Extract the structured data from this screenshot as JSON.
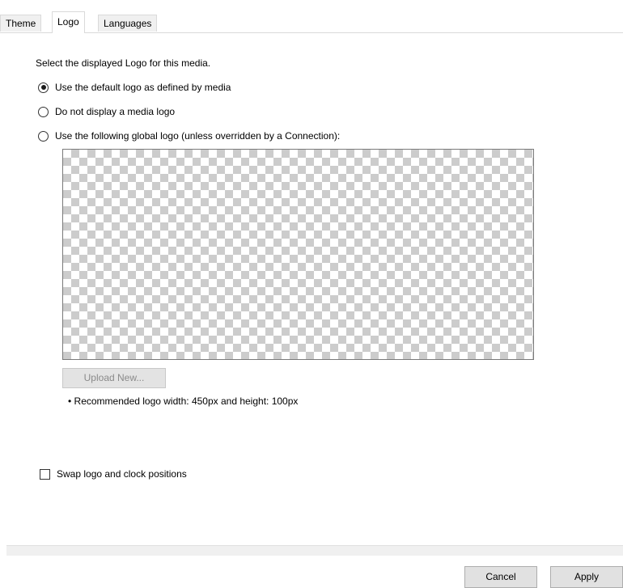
{
  "tabs": [
    {
      "label": "Theme"
    },
    {
      "label": "Logo"
    },
    {
      "label": "Languages"
    }
  ],
  "active_tab": "Logo",
  "logo": {
    "prompt": "Select the displayed Logo for this media.",
    "options": [
      {
        "label": "Use the default logo as defined by media",
        "checked": true
      },
      {
        "label": "Do not display a media logo",
        "checked": false
      },
      {
        "label": "Use the following global logo (unless overridden by a Connection):",
        "checked": false
      }
    ],
    "upload_label": "Upload New...",
    "hint": "• Recommended logo width: 450px and height: 100px",
    "swap_label": "Swap logo and clock positions",
    "swap_checked": false
  },
  "footer": {
    "cancel_label": "Cancel",
    "apply_label": "Apply"
  }
}
